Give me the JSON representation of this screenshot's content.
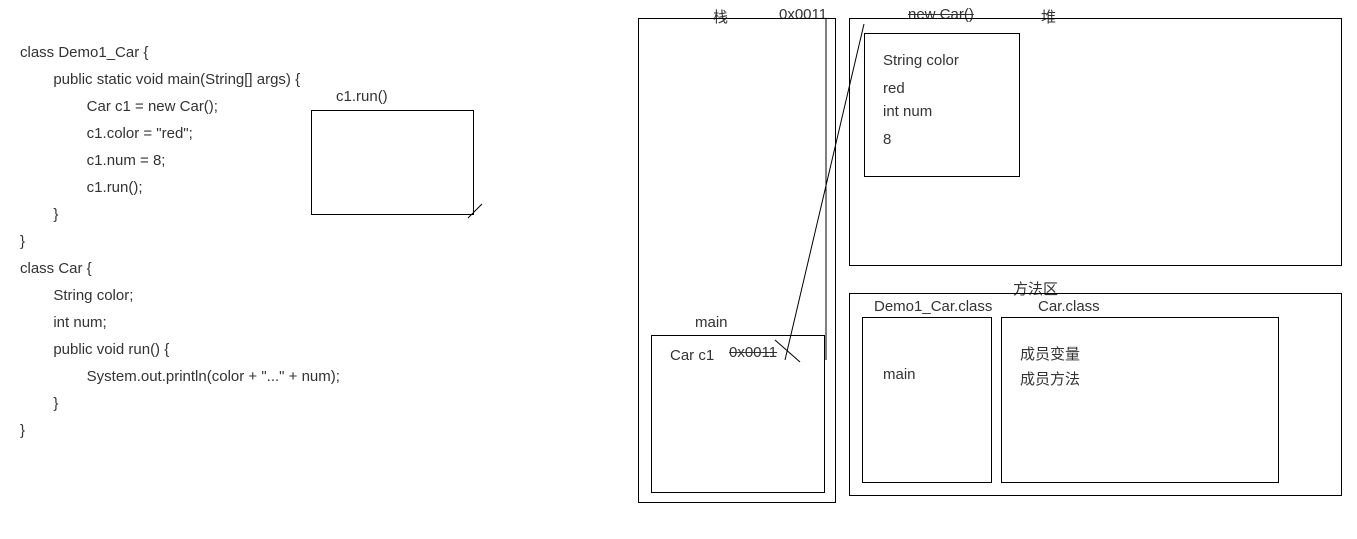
{
  "code": {
    "l1": "class Demo1_Car {",
    "l2": "        public static void main(String[] args) {",
    "l3": "                Car c1 = new Car();",
    "l4": "                c1.color = \"red\";",
    "l5": "                c1.num = 8;",
    "l6": "                c1.run();",
    "l7": "        }",
    "l8": "}",
    "l9": "class Car {",
    "l10": "        String color;",
    "l11": "        int num;",
    "l12": "        public void run() {",
    "l13": "                System.out.println(color + \"...\" + num);",
    "l14": "        }",
    "l15": "}"
  },
  "runbox_label": "c1.run()",
  "stack": {
    "title": "栈",
    "addr_top": "0x0011",
    "frame_label": "main",
    "var": "Car c1",
    "var_addr": "0x0011"
  },
  "heap": {
    "title": "堆",
    "obj_label": "new Car()",
    "field1": "String color",
    "val1": "red",
    "field2": "int num",
    "val2": "8"
  },
  "method_area": {
    "title": "方法区",
    "box1_title": "Demo1_Car.class",
    "box1_line": "main",
    "box2_title": "Car.class",
    "box2_line1": "成员变量",
    "box2_line2": "成员方法"
  }
}
